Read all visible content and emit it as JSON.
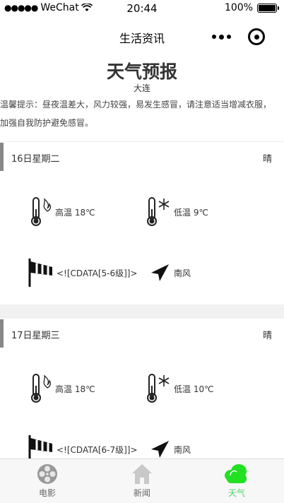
{
  "status": {
    "carrier": "WeChat",
    "time": "20:44",
    "battery": "100%",
    "battery_level": 1.0
  },
  "nav": {
    "title": "生活资讯"
  },
  "page": {
    "title": "天气预报",
    "city": "大连"
  },
  "tips": "温馨提示：昼夜温差大，风力较强，易发生感冒，请注意适当增减衣服，加强自我防护避免感冒。",
  "days": [
    {
      "date": "16日星期二",
      "condition": "晴",
      "high": "高温 18℃",
      "low": "低温 9℃",
      "wind_level": "<![CDATA[5-6级]]>",
      "wind_dir": "南风"
    },
    {
      "date": "17日星期三",
      "condition": "晴",
      "high": "高温 18℃",
      "low": "低温 10℃",
      "wind_level": "<![CDATA[6-7级]]>",
      "wind_dir": "南风"
    }
  ],
  "tabs": [
    {
      "label": "电影",
      "icon": "film-reel-icon",
      "active": false
    },
    {
      "label": "新闻",
      "icon": "home-icon",
      "active": false
    },
    {
      "label": "天气",
      "icon": "cloud-icon",
      "active": true
    }
  ],
  "colors": {
    "active_tab": "#4cd964",
    "inactive_icon": "#aaaaaa",
    "accent_bar": "#888888"
  }
}
